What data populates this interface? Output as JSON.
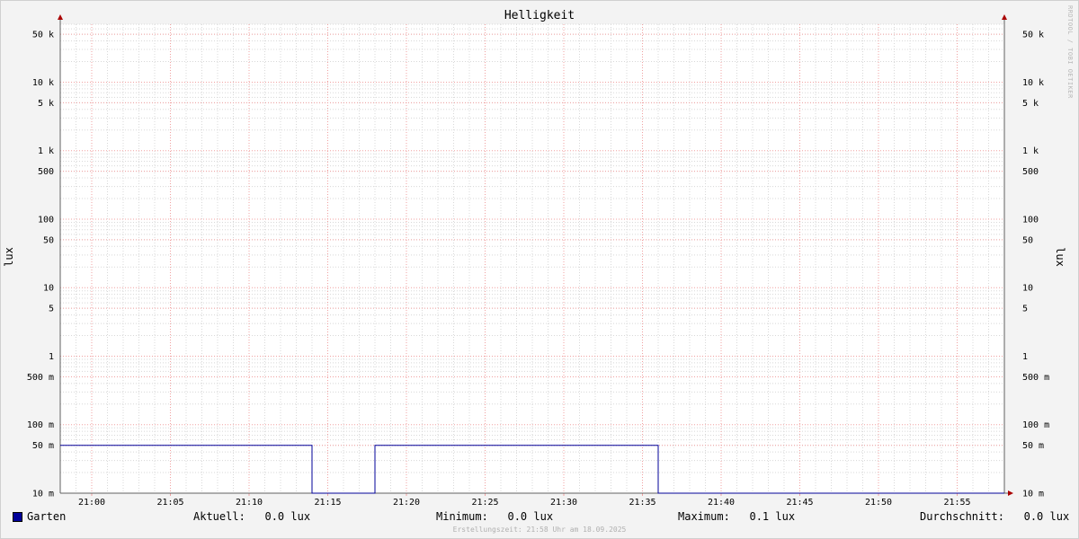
{
  "chart_data": {
    "type": "line",
    "title": "Helligkeit",
    "ylabel": "lux",
    "y_scale": "log",
    "ylim": [
      0.01,
      70000
    ],
    "xlim": [
      "20:58",
      "21:58"
    ],
    "x_ticks": [
      "21:00",
      "21:05",
      "21:10",
      "21:15",
      "21:20",
      "21:25",
      "21:30",
      "21:35",
      "21:40",
      "21:45",
      "21:50",
      "21:55"
    ],
    "y_ticks": [
      {
        "value": 50000,
        "label": "50 k"
      },
      {
        "value": 10000,
        "label": "10 k"
      },
      {
        "value": 5000,
        "label": "5 k"
      },
      {
        "value": 1000,
        "label": "1 k"
      },
      {
        "value": 500,
        "label": "500"
      },
      {
        "value": 100,
        "label": "100"
      },
      {
        "value": 50,
        "label": "50"
      },
      {
        "value": 10,
        "label": "10"
      },
      {
        "value": 5,
        "label": "5"
      },
      {
        "value": 1,
        "label": "1"
      },
      {
        "value": 0.5,
        "label": "500 m"
      },
      {
        "value": 0.1,
        "label": "100 m"
      },
      {
        "value": 0.05,
        "label": "50 m"
      },
      {
        "value": 0.01,
        "label": "10 m"
      }
    ],
    "grid": true,
    "series": [
      {
        "name": "Garten",
        "color": "#000099",
        "x": [
          "20:58",
          "21:14",
          "21:14",
          "21:18",
          "21:18",
          "21:36",
          "21:36",
          "21:58"
        ],
        "y": [
          0.05,
          0.05,
          0.01,
          0.01,
          0.05,
          0.05,
          0.01,
          0.01
        ]
      }
    ]
  },
  "legend": {
    "series_name": "Garten",
    "current": "Aktuell:   0.0 lux",
    "minimum": "Minimum:   0.0 lux",
    "maximum": "Maximum:   0.1 lux",
    "average": "Durchschnitt:   0.0 lux"
  },
  "watermark": "RRDTOOL / TOBI OETIKER",
  "footer": "Erstellungszeit: 21:58 Uhr am 18.09.2025"
}
